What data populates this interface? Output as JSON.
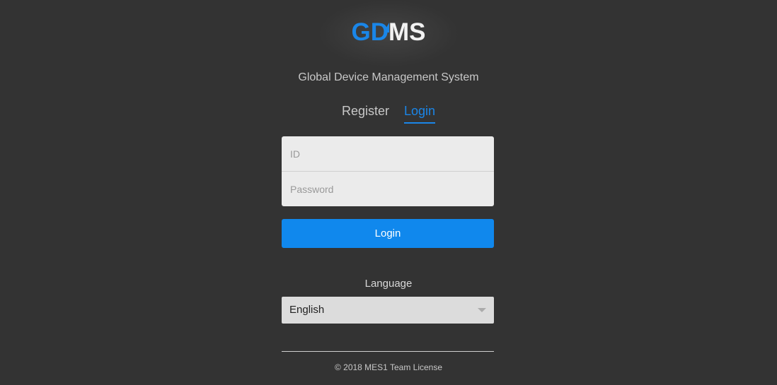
{
  "logo": {
    "part_blue": "GD",
    "part_white": "MS"
  },
  "subtitle": "Global Device Management System",
  "tabs": [
    {
      "label": "Register",
      "active": false
    },
    {
      "label": "Login",
      "active": true
    }
  ],
  "form": {
    "id_placeholder": "ID",
    "id_value": "",
    "password_placeholder": "Password",
    "password_value": "",
    "login_label": "Login"
  },
  "language": {
    "label": "Language",
    "selected": "English"
  },
  "footer": "© 2018 MES1 Team License",
  "colors": {
    "background": "#333333",
    "accent": "#1088ed",
    "input_bg": "#ebebeb"
  }
}
